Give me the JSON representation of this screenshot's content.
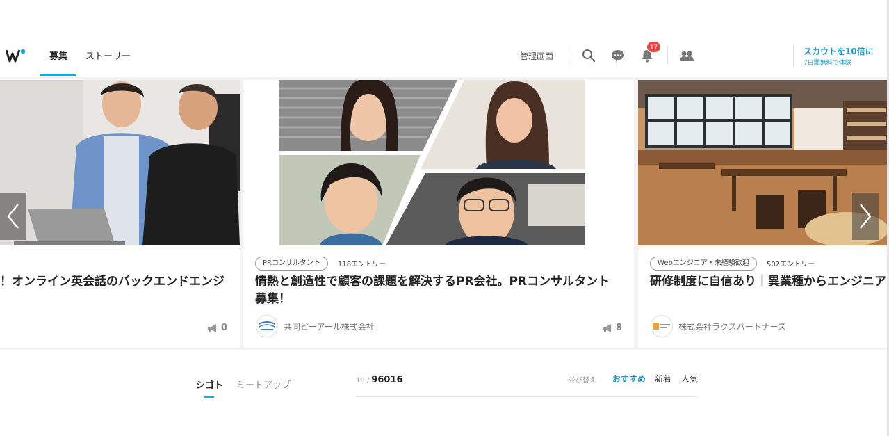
{
  "header": {
    "tabs": [
      {
        "label": "募集",
        "active": true
      },
      {
        "label": "ストーリー",
        "active": false
      }
    ],
    "admin_link": "管理画面",
    "notification_count": "17",
    "scout_promo": {
      "line1": "スカウトを10倍に",
      "line2": "7日間無料で体験"
    }
  },
  "cards": [
    {
      "tag": "",
      "title": "！オンライン英会話のバックエンドエンジ",
      "entries": "",
      "company": "",
      "bookmark_count": "0"
    },
    {
      "tag": "PRコンサルタント",
      "entries": "118エントリー",
      "title_line1": "情熱と創造性で顧客の課題を解決するPR会社。PRコンサルタント",
      "title_line2": "募集！",
      "company": "共同ピーアール株式会社",
      "bookmark_count": "8"
    },
    {
      "tag": "Webエンジニア・未経験歓迎",
      "entries": "502エントリー",
      "title": "研修制度に自信あり｜異業種からエンジニア",
      "company": "株式会社ラクスパートナーズ",
      "bookmark_count": ""
    }
  ],
  "bottom": {
    "tabs": [
      {
        "label": "シゴト",
        "active": true
      },
      {
        "label": "ミートアップ",
        "active": false
      }
    ],
    "count_current": "10 /",
    "count_total": "96016",
    "sort_label": "並び替え",
    "sort_options": [
      {
        "label": "おすすめ",
        "active": true
      },
      {
        "label": "新着",
        "active": false
      },
      {
        "label": "人気",
        "active": false
      }
    ]
  },
  "colors": {
    "accent": "#19a7e0",
    "badge": "#e84545"
  }
}
